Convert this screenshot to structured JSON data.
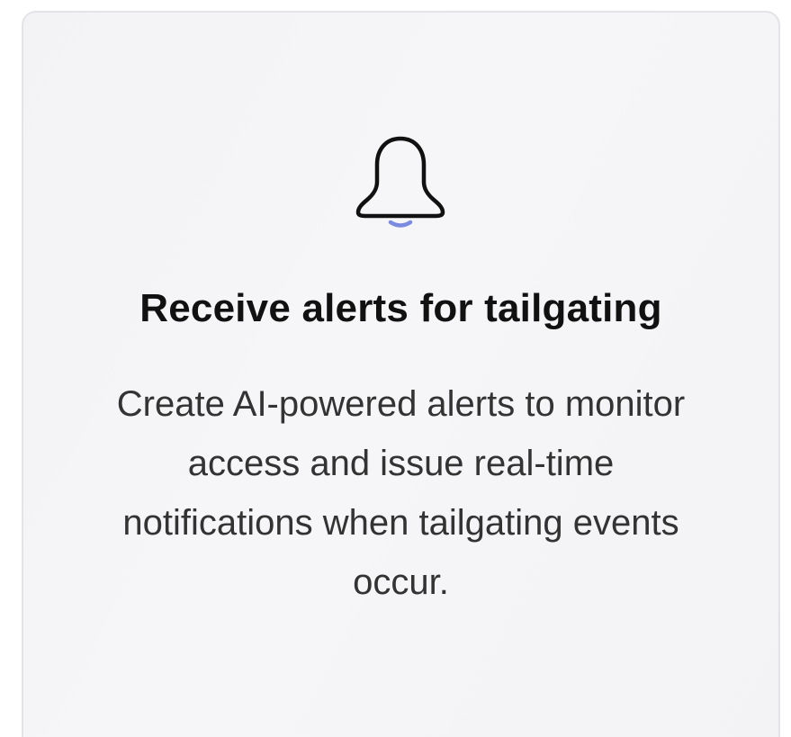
{
  "card": {
    "icon": "bell-icon",
    "title": "Receive alerts for tailgating",
    "description": "Create AI-powered alerts to monitor access and issue real-time notifications when tailgating events occur."
  },
  "colors": {
    "card_background": "#f4f4f7",
    "card_border": "#e3e4e8",
    "title_text": "#111111",
    "body_text": "#333333",
    "icon_stroke": "#111111",
    "icon_accent": "#7b8ce0"
  }
}
